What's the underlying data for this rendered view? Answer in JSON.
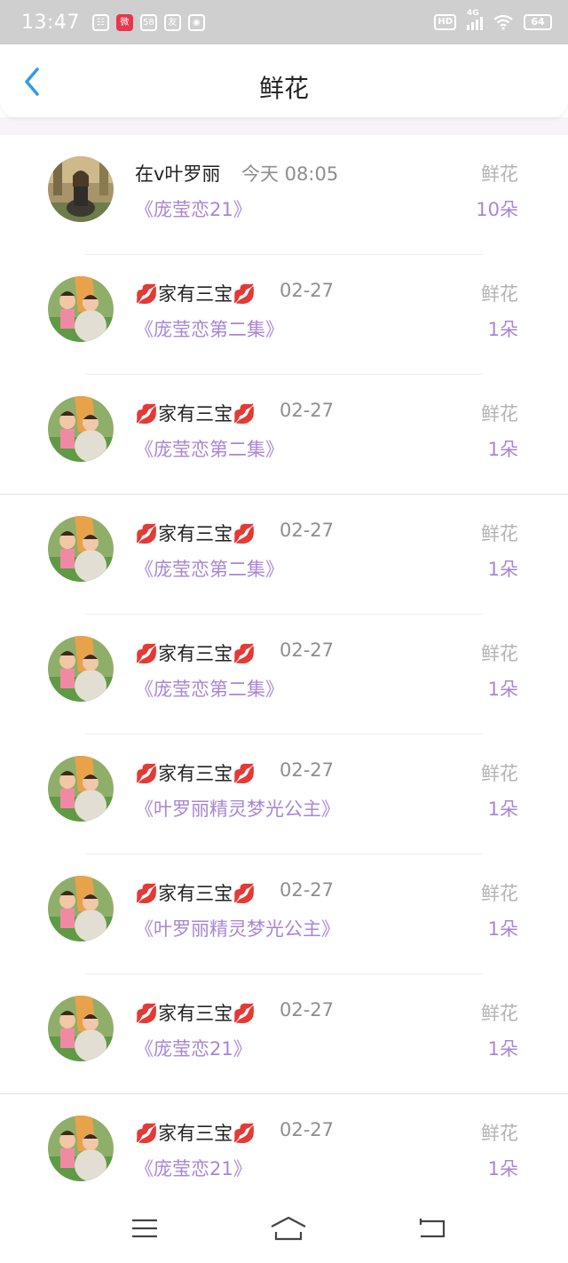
{
  "status_bar": {
    "time": "13:47",
    "app_icons": [
      "☷",
      "微",
      "58",
      "友",
      "◉"
    ],
    "hd_label": "HD",
    "network_label": "4G",
    "battery": "64"
  },
  "header": {
    "title": "鲜花",
    "back_icon": "chevron-left-icon"
  },
  "gifts": [
    {
      "user": "在v叶罗丽",
      "date": "今天 08:05",
      "book": "《庞莹恋21》",
      "type": "鲜花",
      "count": "10朵",
      "avatar": "girl-sitting"
    },
    {
      "user": "💋家有三宝💋",
      "date": "02-27",
      "book": "《庞莹恋第二集》",
      "type": "鲜花",
      "count": "1朵",
      "avatar": "kids"
    },
    {
      "user": "💋家有三宝💋",
      "date": "02-27",
      "book": "《庞莹恋第二集》",
      "type": "鲜花",
      "count": "1朵",
      "avatar": "kids"
    },
    {
      "user": "💋家有三宝💋",
      "date": "02-27",
      "book": "《庞莹恋第二集》",
      "type": "鲜花",
      "count": "1朵",
      "avatar": "kids"
    },
    {
      "user": "💋家有三宝💋",
      "date": "02-27",
      "book": "《庞莹恋第二集》",
      "type": "鲜花",
      "count": "1朵",
      "avatar": "kids"
    },
    {
      "user": "💋家有三宝💋",
      "date": "02-27",
      "book": "《叶罗丽精灵梦光公主》",
      "type": "鲜花",
      "count": "1朵",
      "avatar": "kids"
    },
    {
      "user": "💋家有三宝💋",
      "date": "02-27",
      "book": "《叶罗丽精灵梦光公主》",
      "type": "鲜花",
      "count": "1朵",
      "avatar": "kids"
    },
    {
      "user": "💋家有三宝💋",
      "date": "02-27",
      "book": "《庞莹恋21》",
      "type": "鲜花",
      "count": "1朵",
      "avatar": "kids"
    },
    {
      "user": "💋家有三宝💋",
      "date": "02-27",
      "book": "《庞莹恋21》",
      "type": "鲜花",
      "count": "1朵",
      "avatar": "kids"
    }
  ],
  "system_nav": {
    "icons": [
      "menu-icon",
      "home-icon",
      "back-icon"
    ]
  },
  "colors": {
    "accent_purple": "#a986d6",
    "back_arrow_blue": "#2f9be6",
    "status_bar": "#cfcfcf"
  }
}
